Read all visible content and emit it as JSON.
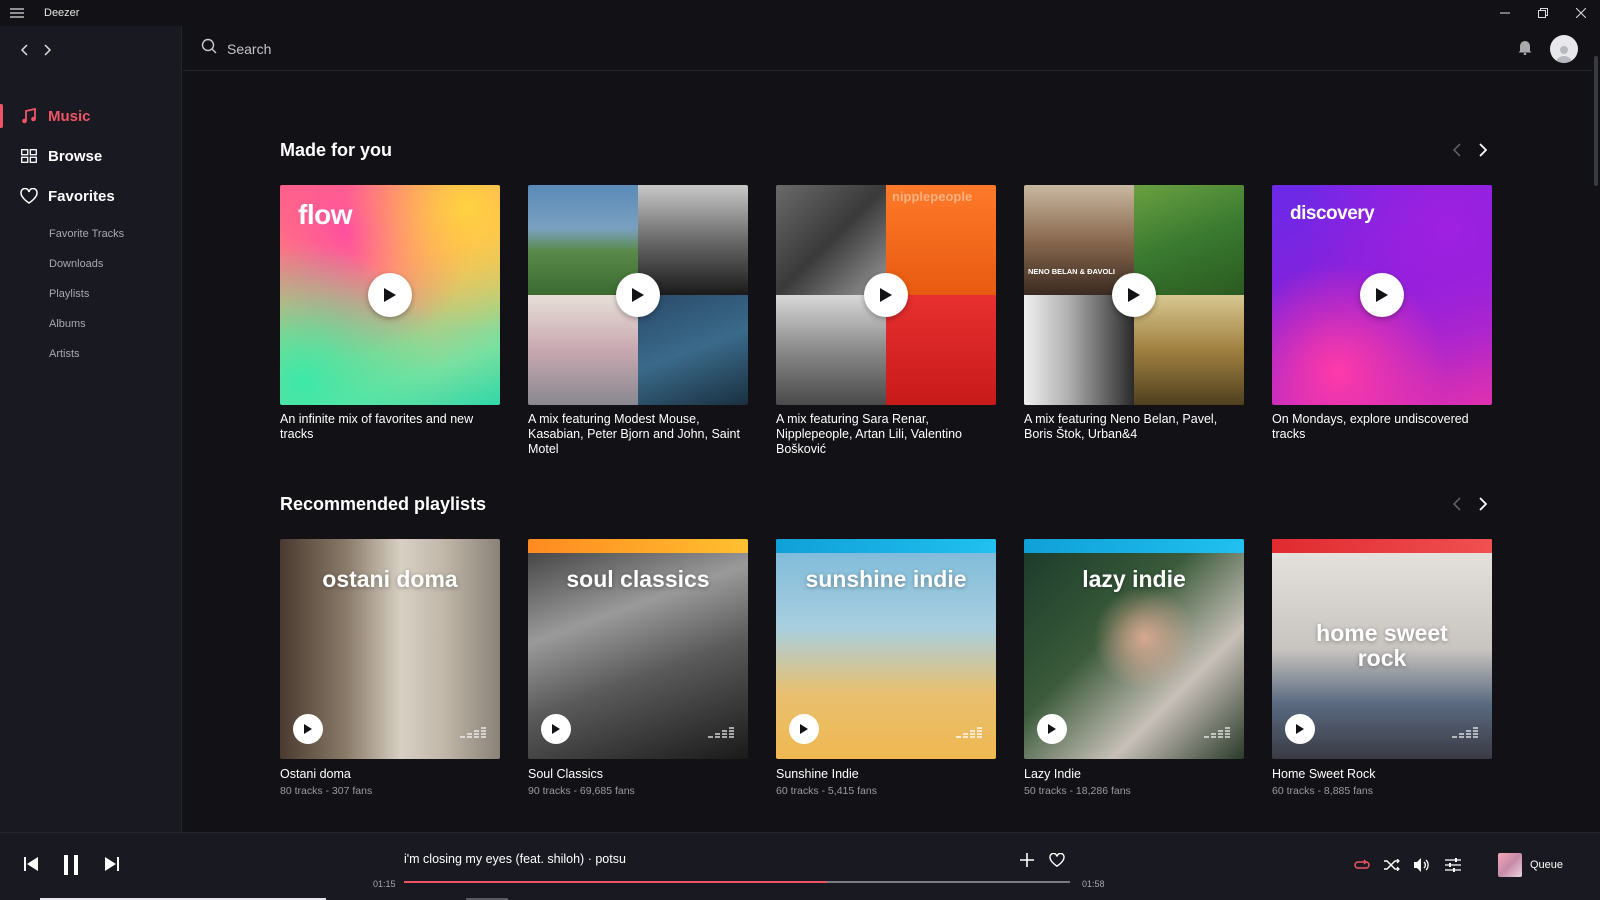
{
  "app": {
    "title": "Deezer"
  },
  "sidebar": {
    "main": [
      {
        "label": "Music",
        "icon": "music-note-icon",
        "active": true
      },
      {
        "label": "Browse",
        "icon": "grid-icon",
        "active": false
      },
      {
        "label": "Favorites",
        "icon": "heart-icon",
        "active": false
      }
    ],
    "sub": [
      "Favorite Tracks",
      "Downloads",
      "Playlists",
      "Albums",
      "Artists"
    ]
  },
  "search": {
    "placeholder": "Search"
  },
  "sections": {
    "made_for_you": {
      "title": "Made for you",
      "cards": [
        {
          "cover_label": "flow",
          "description": "An infinite mix of favorites and new tracks"
        },
        {
          "cover_label": "",
          "description": "A mix featuring Modest Mouse, Kasabian, Peter Bjorn and John, Saint Motel"
        },
        {
          "cover_label": "nipplepeople",
          "description": "A mix featuring Sara Renar, Nipplepeople, Artan Lili, Valentino Bošković"
        },
        {
          "cover_label": "NENO BELAN & ĐAVOLI",
          "description": "A mix featuring Neno Belan, Pavel, Boris Štok, Urban&4"
        },
        {
          "cover_label": "discovery",
          "description": "On Mondays, explore undiscovered tracks"
        }
      ]
    },
    "recommended": {
      "title": "Recommended playlists",
      "cards": [
        {
          "cover_label": "ostani doma",
          "name": "Ostani doma",
          "meta": "80 tracks - 307 fans"
        },
        {
          "cover_label": "soul classics",
          "name": "Soul Classics",
          "meta": "90 tracks - 69,685 fans"
        },
        {
          "cover_label": "sunshine indie",
          "name": "Sunshine Indie",
          "meta": "60 tracks - 5,415 fans"
        },
        {
          "cover_label": "lazy indie",
          "name": "Lazy Indie",
          "meta": "50 tracks - 18,286 fans"
        },
        {
          "cover_label": "home sweet rock",
          "name": "Home Sweet Rock",
          "meta": "60 tracks - 8,885 fans"
        }
      ]
    }
  },
  "player": {
    "track": "i'm closing my eyes (feat. shiloh) · potsu",
    "elapsed": "01:15",
    "duration": "01:58",
    "progress": 0.635,
    "queue_label": "Queue"
  },
  "colors": {
    "accent": "#ef5466",
    "background": "#121216",
    "sidebar": "#191922"
  }
}
